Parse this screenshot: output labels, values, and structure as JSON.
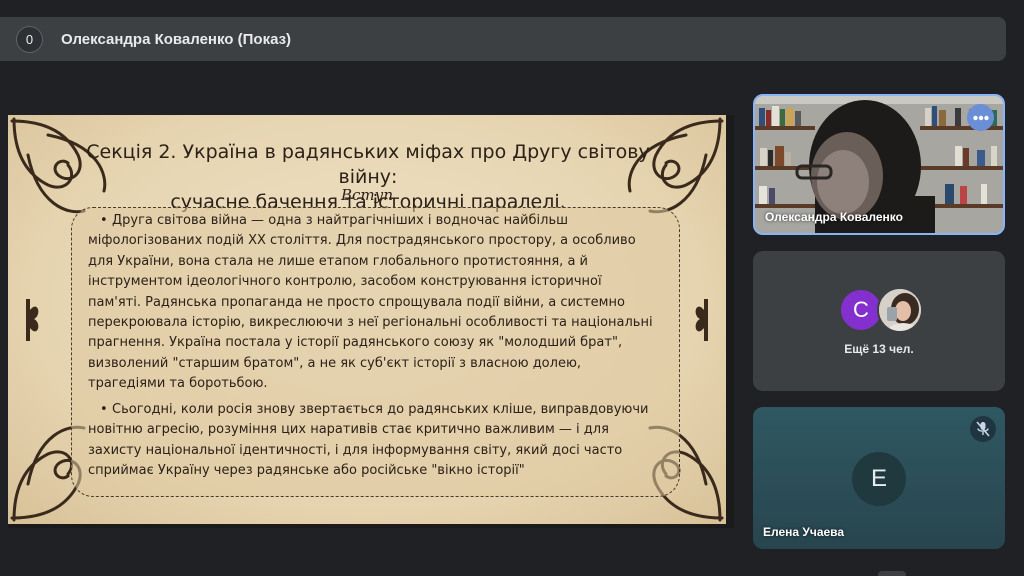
{
  "topbar": {
    "participant_count": "0",
    "presenter_title": "Олександра Коваленко (Показ)"
  },
  "slide": {
    "title_line1": "Секція 2. Україна в радянських міфах про Другу світову війну:",
    "title_line2": "сучасне бачення та історичні паралелі.",
    "subtitle": "Вступ",
    "paragraph1": "Друга світова війна — одна з найтрагічніших і водночас найбільш міфологізованих подій ХХ століття. Для пострадянського простору, а особливо для України, вона стала не лише етапом глобального протистояння, а й інструментом ідеологічного контролю, засобом конструювання історичної пам'яті. Радянська пропаганда не просто спрощувала події війни, а системно перекроювала історію, викреслюючи з неї регіональні особливості та національні прагнення. Україна постала у історії радянського союзу як \"молодший брат\", визволений \"старшим братом\", а не як суб'єкт історії з власною долею, трагедіями та боротьбою.",
    "paragraph2": "Сьогодні, коли росія знову звертається до радянських кліше, виправдовуючи новітню агресію, розуміння цих наративів стає критично важливим — і для захисту національної ідентичності, і для інформування світу, який досі часто сприймає Україну через радянське або російське \"вікно історії\"",
    "bullet_symbol": "•"
  },
  "tiles": {
    "presenter": {
      "name": "Олександра Коваленко",
      "more_icon": "more-horiz-icon"
    },
    "others": {
      "avatar_letter": "С",
      "avatar_color": "#8430ce",
      "label": "Ещё 13 чел."
    },
    "user": {
      "avatar_letter": "Е",
      "name": "Елена Учаева",
      "mic_icon": "mic-off-icon"
    }
  },
  "colors": {
    "accent": "#8ab4f8",
    "surface": "#3c4043",
    "background": "#202124"
  }
}
